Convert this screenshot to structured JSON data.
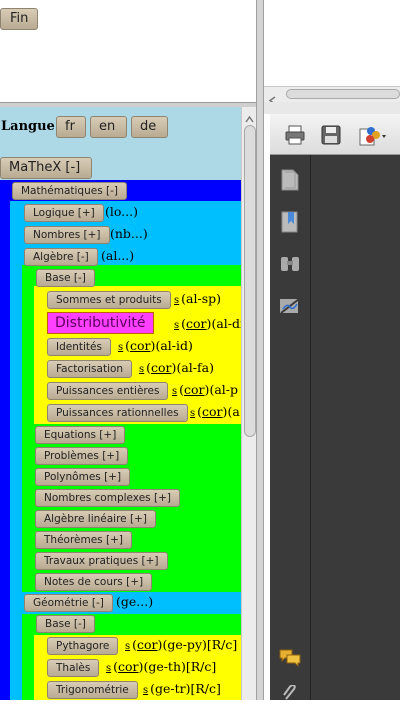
{
  "top": {
    "fin_label": "Fin"
  },
  "langue": {
    "label": "Langue",
    "options": [
      "fr",
      "en",
      "de"
    ]
  },
  "mathex_label": "MaTheX [-]",
  "math": {
    "label": "Mathématiques [-]"
  },
  "logique": {
    "label": "Logique [+]",
    "code": "(lo...)"
  },
  "nombres": {
    "label": "Nombres [+]",
    "code": "(nb...)"
  },
  "algebre": {
    "label": "Algèbre [-]",
    "code": "(al...)"
  },
  "alg_base": {
    "label": "Base [-]"
  },
  "base_items": [
    {
      "label": "Sommes et produits",
      "s": "s",
      "cor": "",
      "code": "(al-sp)"
    },
    {
      "label": "Distributivité",
      "s": "s",
      "cor": "cor",
      "code": "(al-di"
    },
    {
      "label": "Identités",
      "s": "s",
      "cor": "cor",
      "code": "(al-id)"
    },
    {
      "label": "Factorisation",
      "s": "s",
      "cor": "cor",
      "code": "(al-fa)"
    },
    {
      "label": "Puissances entières",
      "s": "s",
      "cor": "cor",
      "code": "(al-p"
    },
    {
      "label": "Puissances rationnelles",
      "s": "s",
      "cor": "cor",
      "code": "(a"
    }
  ],
  "alg_items": [
    "Equations [+]",
    "Problèmes [+]",
    "Polynômes [+]",
    "Nombres complexes [+]",
    "Algèbre linéaire [+]",
    "Théorèmes [+]",
    "Travaux pratiques [+]",
    "Notes de cours [+]"
  ],
  "geometrie": {
    "label": "Géométrie [-]",
    "code": "(ge...)"
  },
  "geo_base": {
    "label": "Base [-]"
  },
  "geo_items": [
    {
      "label": "Pythagore",
      "s": "s",
      "cor": "cor",
      "code": "(ge-py)[R/c]"
    },
    {
      "label": "Thalès",
      "s": "s",
      "cor": "cor",
      "code": "(ge-th)[R/c]"
    },
    {
      "label": "Trigonométrie",
      "s": "s",
      "cor": "",
      "code": "(ge-tr)[R/c]"
    }
  ],
  "colors": {
    "panel_bg": "#add8e6",
    "math_blue": "#0000ff",
    "cyan": "#00bfff",
    "green": "#00ff00",
    "yellow": "#ffff00",
    "magenta": "#ff40ff",
    "pdf_dark": "#3a3a3a"
  },
  "icons": [
    "print-icon",
    "save-icon",
    "share-icon",
    "page-icon",
    "bookmark-icon",
    "binoculars-icon",
    "signature-icon",
    "comment-icon",
    "attach-icon"
  ]
}
